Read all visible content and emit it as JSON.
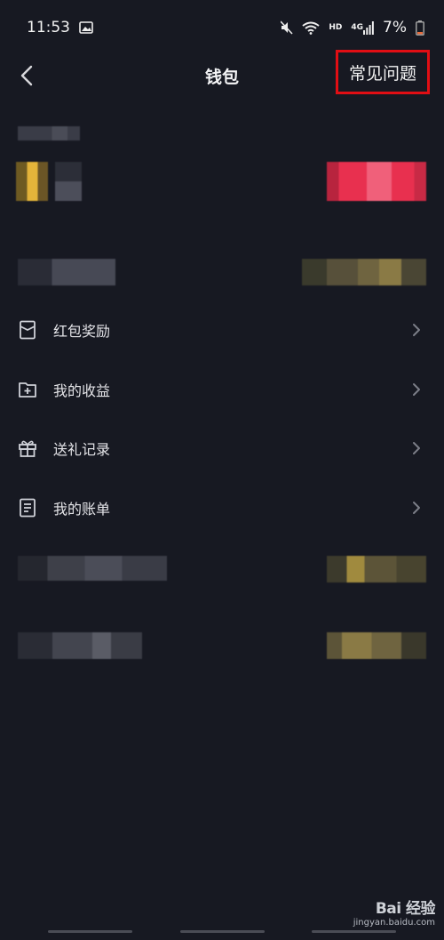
{
  "status_bar": {
    "time": "11:53",
    "hd": "HD",
    "signal": "4G",
    "battery": "7%"
  },
  "header": {
    "title": "钱包",
    "faq_label": "常见问题"
  },
  "menu": [
    {
      "label": "红包奖励",
      "icon": "red-packet-icon"
    },
    {
      "label": "我的收益",
      "icon": "earnings-icon"
    },
    {
      "label": "送礼记录",
      "icon": "gift-icon"
    },
    {
      "label": "我的账单",
      "icon": "bill-icon"
    }
  ],
  "watermark": {
    "brand": "Bai 经验",
    "url": "jingyan.baidu.com"
  },
  "colors": {
    "background": "#171922",
    "highlight_box": "#e10e14",
    "pink_button": "#e8304f",
    "gold_text": "#8a7a45"
  }
}
